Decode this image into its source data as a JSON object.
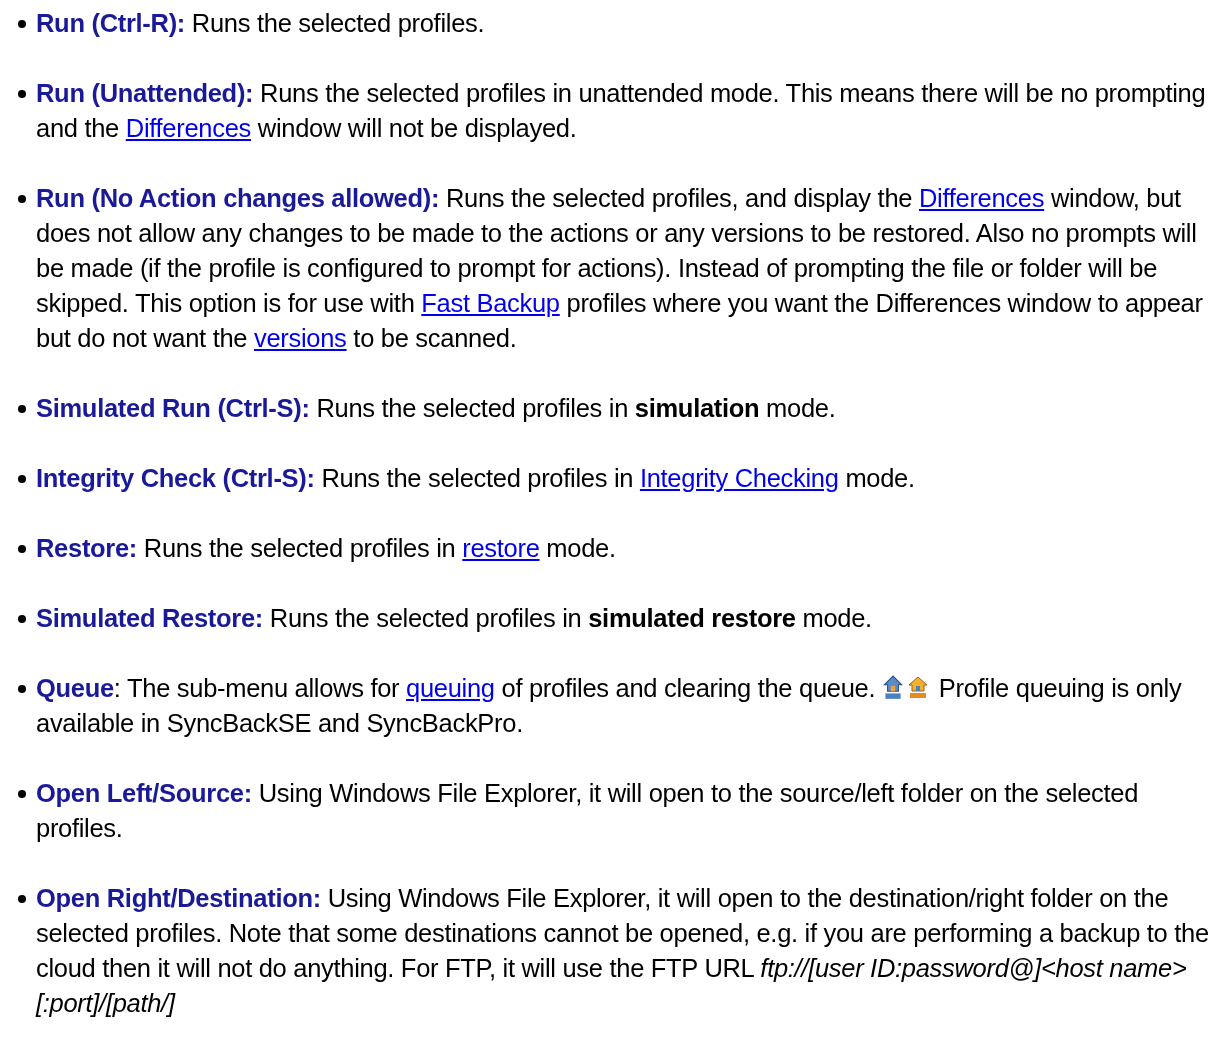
{
  "items": [
    {
      "term": "Run (Ctrl-R):",
      "parts": [
        {
          "kind": "text",
          "text": " Runs the selected profiles."
        }
      ]
    },
    {
      "term": "Run (Unattended):",
      "parts": [
        {
          "kind": "text",
          "text": " Runs the selected profiles in unattended mode. This means there will be no prompting and the "
        },
        {
          "kind": "link",
          "text": "Differences"
        },
        {
          "kind": "text",
          "text": " window will not be displayed."
        }
      ]
    },
    {
      "term": "Run (No Action changes allowed):",
      "parts": [
        {
          "kind": "text",
          "text": " Runs the selected profiles, and display the "
        },
        {
          "kind": "link",
          "text": "Differences"
        },
        {
          "kind": "text",
          "text": " window, but does not allow any changes to be made to the actions or any versions to be restored. Also no prompts will be made (if the profile is configured to prompt for actions). Instead of prompting the file or folder will be skipped. This option is for use with "
        },
        {
          "kind": "link",
          "text": "Fast Backup"
        },
        {
          "kind": "text",
          "text": " profiles where you want the Differences window to appear but do not want the "
        },
        {
          "kind": "link",
          "text": "versions"
        },
        {
          "kind": "text",
          "text": " to be scanned."
        }
      ]
    },
    {
      "term": "Simulated Run (Ctrl-S):",
      "parts": [
        {
          "kind": "text",
          "text": " Runs the selected profiles in **simulation** mode."
        }
      ]
    },
    {
      "term": "Integrity Check (Ctrl-S):",
      "parts": [
        {
          "kind": "text",
          "text": " Runs the selected profiles in "
        },
        {
          "kind": "link",
          "text": "Integrity Checking"
        },
        {
          "kind": "text",
          "text": " mode."
        }
      ]
    },
    {
      "term": "Restore:",
      "parts": [
        {
          "kind": "text",
          "text": " Runs the selected profiles in "
        },
        {
          "kind": "link",
          "text": "restore"
        },
        {
          "kind": "text",
          "text": " mode."
        }
      ]
    },
    {
      "term": "Simulated Restore:",
      "parts": [
        {
          "kind": "text",
          "text": " Runs the selected profiles in **simulated restore** mode."
        }
      ]
    },
    {
      "term": "Queue",
      "parts": [
        {
          "kind": "text",
          "text": ": The sub-menu allows for "
        },
        {
          "kind": "link",
          "text": "queuing"
        },
        {
          "kind": "text",
          "text": " of profiles and clearing the queue. "
        },
        {
          "kind": "icon-se"
        },
        {
          "kind": "icon-pro"
        },
        {
          "kind": "text",
          "text": " Profile queuing is only available in SyncBackSE and SyncBackPro."
        }
      ]
    },
    {
      "term": "Open Left/Source:",
      "parts": [
        {
          "kind": "text",
          "text": " Using Windows File Explorer, it will open to the source/left folder on the selected profiles."
        }
      ]
    },
    {
      "term": "Open Right/Destination:",
      "parts": [
        {
          "kind": "text",
          "text": " Using Windows File Explorer, it will open to the destination/right folder on the selected profiles. Note that some destinations cannot be opened, e.g. if you are performing a backup to the cloud then it will not do anything. For FTP, it will use the FTP URL *ftp://[user ID:password@]<host name>[:port]/[path/]*"
        }
      ]
    }
  ]
}
